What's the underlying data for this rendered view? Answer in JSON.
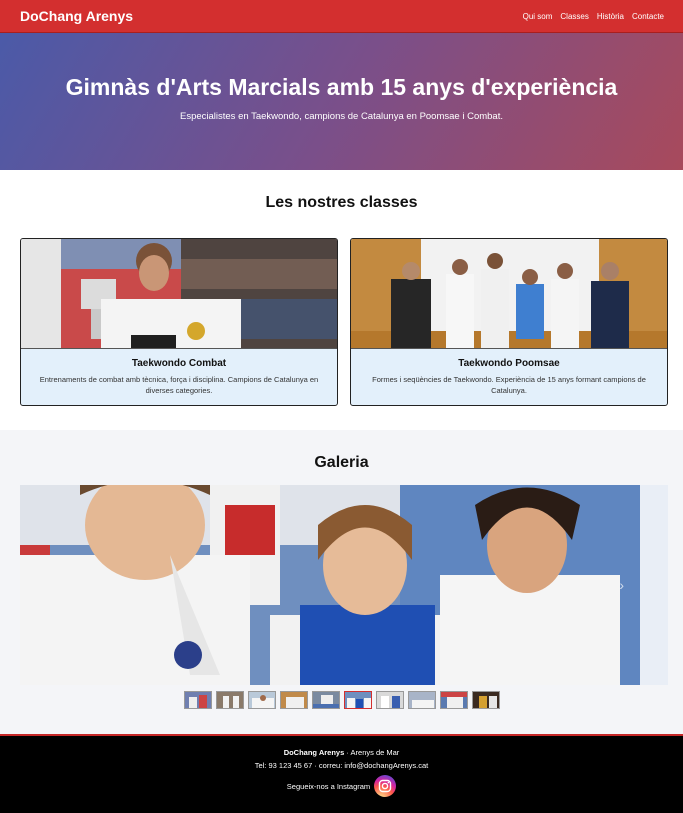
{
  "nav": {
    "brand": "DoChang Arenys",
    "links": [
      "Qui som",
      "Classes",
      "Història",
      "Contacte"
    ]
  },
  "hero": {
    "title": "Gimnàs d'Arts Marcials amb 15 anys d'experiència",
    "subtitle": "Especialistes en Taekwondo, campions de Catalunya en Poomsae i Combat."
  },
  "classes": {
    "heading": "Les nostres classes",
    "cards": [
      {
        "title": "Taekwondo Combat",
        "text": "Entrenaments de combat amb tècnica, força i disciplina. Campions de Catalunya en diverses categories."
      },
      {
        "title": "Taekwondo Poomsae",
        "text": "Formes i seqüències de Taekwondo. Experiència de 15 anys formant campions de Catalunya."
      }
    ]
  },
  "gallery": {
    "heading": "Galeria",
    "next_icon": "chevron-right-icon",
    "thumb_count": 10,
    "active_thumb": 5
  },
  "footer": {
    "name": "DoChang Arenys",
    "location": " · Arenys de Mar",
    "contact": "Tel: 93 123 45 67 · correu: info@dochangArenys.cat",
    "follow": "Segueix-nos a Instagram",
    "instagram_icon": "instagram-icon"
  },
  "colors": {
    "accent": "#d32f2f",
    "card_bg": "#e3f0fb",
    "footer_bg": "#000000"
  }
}
